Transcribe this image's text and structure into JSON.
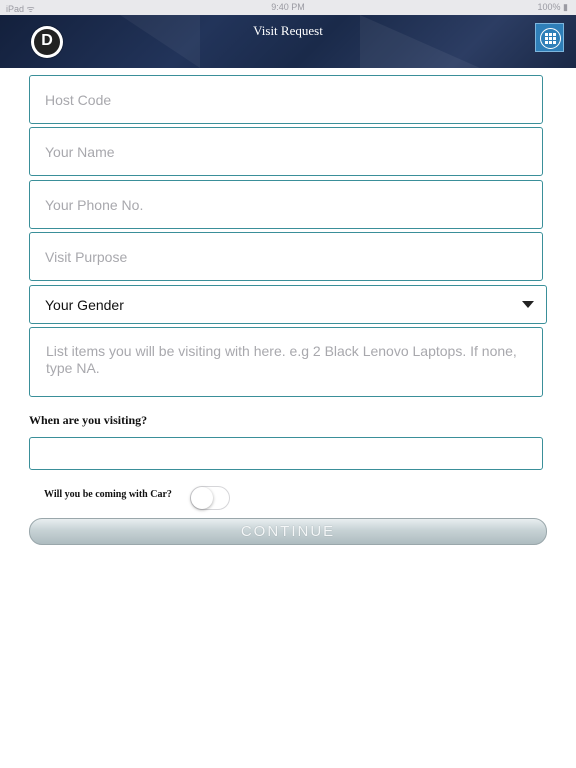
{
  "status_bar": {
    "left": "iPad ᯤ",
    "time": "9:40 PM",
    "right": "100% ▮"
  },
  "header": {
    "title": "Visit Request",
    "logo_glyph": "D"
  },
  "form": {
    "host_code_placeholder": "Host Code",
    "name_placeholder": "Your Name",
    "phone_placeholder": "Your Phone No.",
    "purpose_placeholder": "Visit Purpose",
    "gender_selected": "Your Gender",
    "items_placeholder": "List items you will be visiting with here. e.g 2 Black Lenovo Laptops. If none, type NA.",
    "when_label": "When are you visiting?",
    "date_value": "",
    "car_label": "Will you be coming with Car?",
    "car_toggle_on": false,
    "continue_label": "CONTINUE"
  },
  "colors": {
    "field_border": "#3a8f99",
    "header_bg": "#1a2a4a",
    "menu_button": "#2f7fb8"
  }
}
